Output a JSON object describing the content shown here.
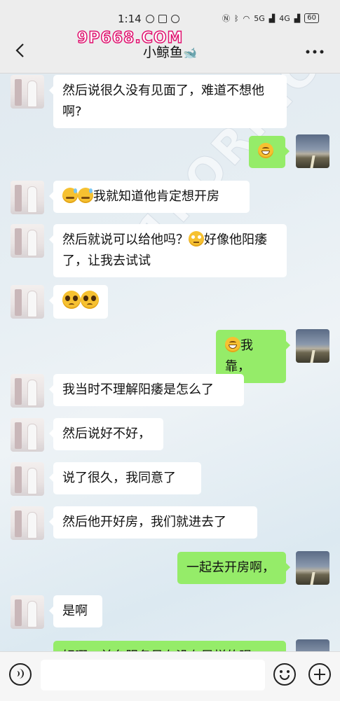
{
  "status_bar": {
    "time": "1:14",
    "network_labels": [
      "5G",
      "4G"
    ],
    "battery": "60"
  },
  "header": {
    "back_icon": "chevron-left-icon",
    "title": "小鲸鱼",
    "title_emoji": "🐋",
    "more_icon": "more-dots-icon"
  },
  "watermarks": {
    "top": "9P668.COM",
    "diagonal": "91PORN.COM"
  },
  "messages": [
    {
      "side": "left",
      "text": "然后说很久没有见面了，难道不想他啊?"
    },
    {
      "side": "right",
      "emojis": [
        "grin"
      ],
      "text": ""
    },
    {
      "side": "left",
      "emojis": [
        "sweat",
        "sweat"
      ],
      "text": "我就知道他肯定想开房"
    },
    {
      "side": "left",
      "text_before": "然后就说可以给他吗？",
      "emojis": [
        "roll"
      ],
      "text": "好像他阳痿了，让我去试试"
    },
    {
      "side": "left",
      "emojis": [
        "plead",
        "plead"
      ],
      "text": ""
    },
    {
      "side": "right",
      "emojis": [
        "grin"
      ],
      "text": "我靠，"
    },
    {
      "side": "left",
      "text": "我当时不理解阳痿是怎么了"
    },
    {
      "side": "left",
      "text": "然后说好不好，"
    },
    {
      "side": "left",
      "text": "说了很久，我同意了"
    },
    {
      "side": "left",
      "text": "然后他开好房，我们就进去了"
    },
    {
      "side": "right",
      "text": "一起去开房啊，"
    },
    {
      "side": "left",
      "text": "是啊"
    },
    {
      "side": "right",
      "text": "好嘢，前台服务员有没有异样的眼"
    }
  ],
  "input_bar": {
    "voice_icon": "voice-icon",
    "emoji_icon": "emoji-icon",
    "plus_icon": "plus-icon",
    "placeholder": ""
  }
}
